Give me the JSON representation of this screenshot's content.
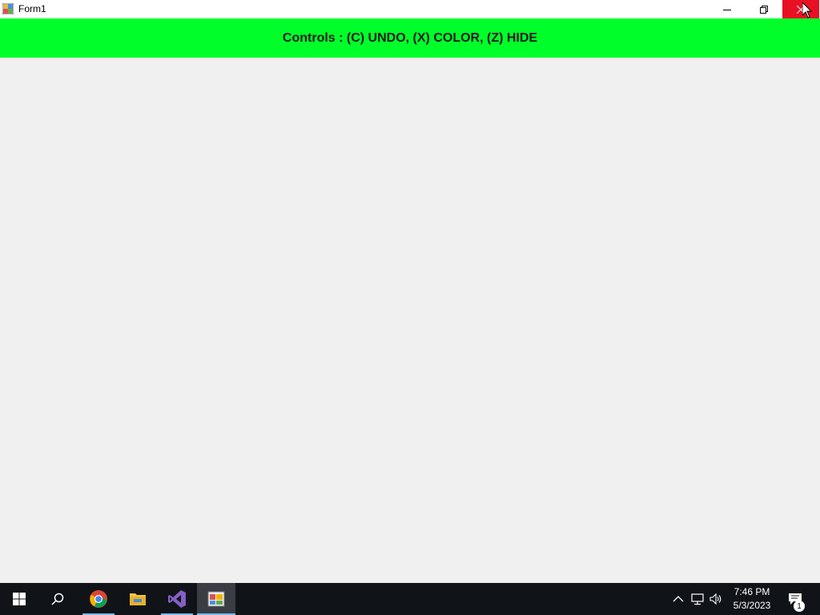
{
  "window": {
    "title": "Form1"
  },
  "banner": {
    "text": "Controls :  (C) UNDO, (X) COLOR, (Z) HIDE",
    "color": "#00ff2a"
  },
  "caption_buttons": {
    "icons": [
      "minimize-icon",
      "restore-icon",
      "close-icon"
    ],
    "close_hover_color": "#e81123"
  },
  "taskbar": {
    "pinned": [
      "start-icon",
      "search-icon",
      "chrome-icon",
      "file-explorer-icon",
      "visual-studio-icon",
      "form-app-icon"
    ],
    "tray_icons": [
      "chevron-up-icon",
      "network-icon",
      "volume-icon"
    ],
    "clock": {
      "time": "7:46 PM",
      "date": "5/3/2023"
    },
    "notifications_count": "1"
  }
}
